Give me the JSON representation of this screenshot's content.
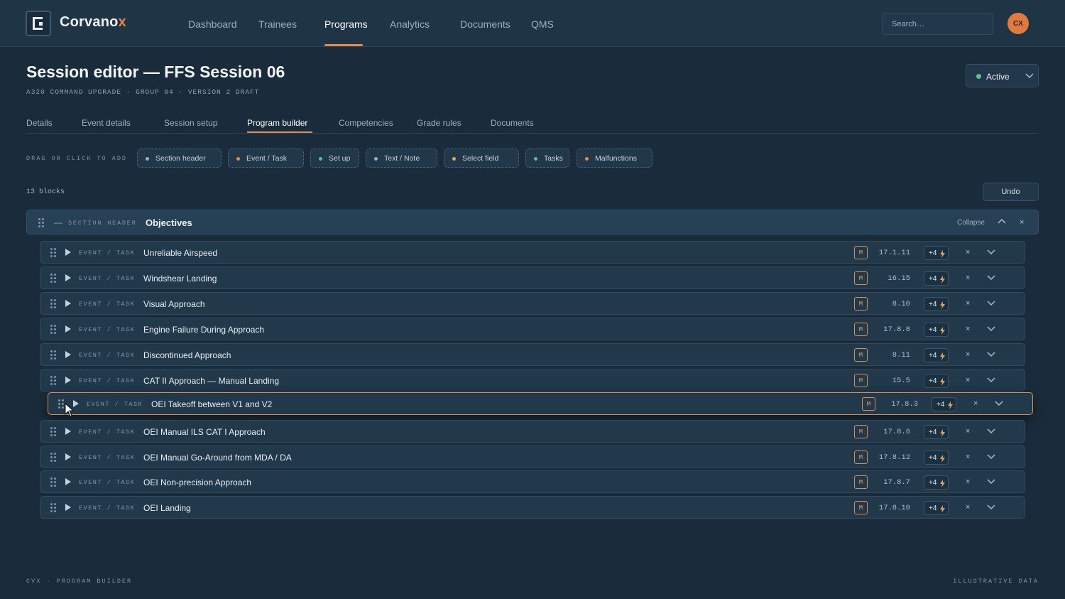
{
  "brand": {
    "name": "Corvano",
    "accent_letter": "x"
  },
  "nav": {
    "items": [
      {
        "label": "Dashboard"
      },
      {
        "label": "Trainees"
      },
      {
        "label": "Programs",
        "active": true
      },
      {
        "label": "Analytics"
      },
      {
        "label": "Documents"
      },
      {
        "label": "QMS"
      }
    ]
  },
  "search": {
    "placeholder": "Search…"
  },
  "user": {
    "initials": "CX"
  },
  "page": {
    "title": "Session editor — FFS Session 06",
    "subtitle": "A320 COMMAND UPGRADE · GROUP 04 · VERSION 2 DRAFT",
    "status": "Active"
  },
  "tabs": [
    {
      "label": "Details"
    },
    {
      "label": "Event details"
    },
    {
      "label": "Session setup"
    },
    {
      "label": "Program builder",
      "active": true
    },
    {
      "label": "Competencies"
    },
    {
      "label": "Grade rules"
    },
    {
      "label": "Documents"
    }
  ],
  "palette": {
    "label": "DRAG OR CLICK TO ADD",
    "chips": [
      {
        "label": "Section header",
        "color": "#9fb1be"
      },
      {
        "label": "Event / Task",
        "color": "#e8884a"
      },
      {
        "label": "Set up",
        "color": "#5cc489"
      },
      {
        "label": "Text / Note",
        "color": "#9fb1be"
      },
      {
        "label": "Select field",
        "color": "#e0b048"
      },
      {
        "label": "Tasks",
        "color": "#5cc489"
      },
      {
        "label": "Malfunctions",
        "color": "#e8884a"
      }
    ]
  },
  "builder": {
    "count_label": "13 blocks",
    "undo_label": "Undo",
    "section": {
      "kind": "SECTION HEADER",
      "dash": "—",
      "title": "Objectives",
      "collapse_label": "Collapse",
      "close": "×"
    },
    "event_kind": "EVENT / TASK",
    "marker": "M",
    "close": "×",
    "events": [
      {
        "title": "Unreliable Airspeed",
        "code": "17.1.11",
        "badge": "+4"
      },
      {
        "title": "Windshear Landing",
        "code": "16.15",
        "badge": "+4"
      },
      {
        "title": "Visual Approach",
        "code": "8.10",
        "badge": "+4"
      },
      {
        "title": "Engine Failure During Approach",
        "code": "17.8.8",
        "badge": "+4"
      },
      {
        "title": "Discontinued Approach",
        "code": "8.11",
        "badge": "+4"
      },
      {
        "title": "CAT II Approach — Manual Landing",
        "code": "15.5",
        "badge": "+4"
      },
      {
        "title": "OEI Takeoff between V1 and V2",
        "code": "17.8.3",
        "badge": "+4",
        "dragging": true
      },
      {
        "title": "OEI Manual ILS CAT I Approach",
        "code": "17.8.6",
        "badge": "+4"
      },
      {
        "title": "OEI Manual Go-Around from MDA / DA",
        "code": "17.8.12",
        "badge": "+4"
      },
      {
        "title": "OEI Non-precision Approach",
        "code": "17.8.7",
        "badge": "+4"
      },
      {
        "title": "OEI Landing",
        "code": "17.8.10",
        "badge": "+4"
      }
    ]
  },
  "footer": {
    "left": "CVX · PROGRAM BUILDER",
    "right": "ILLUSTRATIVE DATA"
  },
  "colors": {
    "accent": "#e8884a",
    "active_status": "#5cc489",
    "background": "#1a2c3b"
  }
}
